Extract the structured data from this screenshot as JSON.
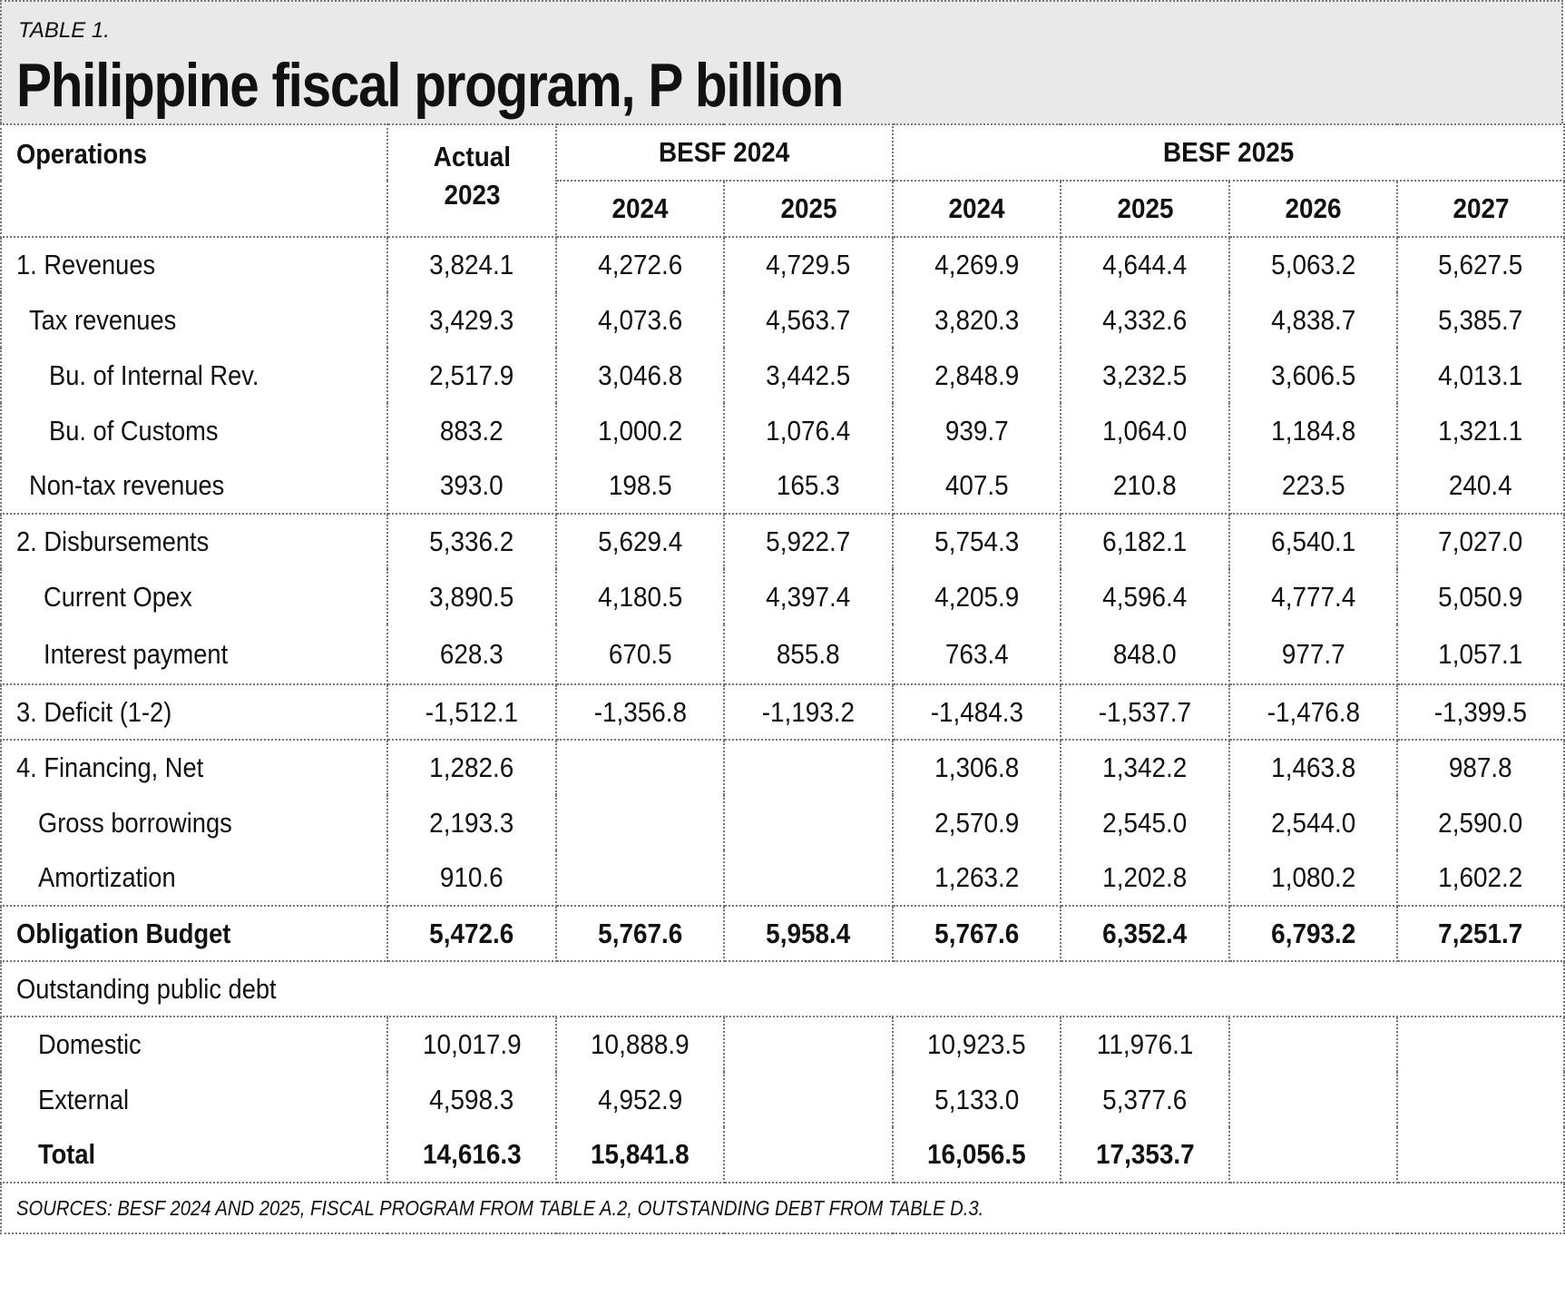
{
  "label": "TABLE 1.",
  "title": "Philippine fiscal program, P billion",
  "headers": {
    "operations": "Operations",
    "actual_line1": "Actual",
    "actual_line2": "2023",
    "besf2024": "BESF 2024",
    "besf2025": "BESF 2025",
    "years": [
      "2024",
      "2025",
      "2024",
      "2025",
      "2026",
      "2027"
    ]
  },
  "rows": [
    {
      "label": "1. Revenues",
      "values": [
        "3,824.1",
        "4,272.6",
        "4,729.5",
        "4,269.9",
        "4,644.4",
        "5,063.2",
        "5,627.5"
      ]
    },
    {
      "label": "Tax revenues",
      "values": [
        "3,429.3",
        "4,073.6",
        "4,563.7",
        "3,820.3",
        "4,332.6",
        "4,838.7",
        "5,385.7"
      ]
    },
    {
      "label": "Bu. of Internal Rev.",
      "values": [
        "2,517.9",
        "3,046.8",
        "3,442.5",
        "2,848.9",
        "3,232.5",
        "3,606.5",
        "4,013.1"
      ]
    },
    {
      "label": "Bu. of Customs",
      "values": [
        "883.2",
        "1,000.2",
        "1,076.4",
        "939.7",
        "1,064.0",
        "1,184.8",
        "1,321.1"
      ]
    },
    {
      "label": "Non-tax revenues",
      "values": [
        "393.0",
        "198.5",
        "165.3",
        "407.5",
        "210.8",
        "223.5",
        "240.4"
      ]
    },
    {
      "label": "2. Disbursements",
      "values": [
        "5,336.2",
        "5,629.4",
        "5,922.7",
        "5,754.3",
        "6,182.1",
        "6,540.1",
        "7,027.0"
      ]
    },
    {
      "label": "Current Opex",
      "values": [
        "3,890.5",
        "4,180.5",
        "4,397.4",
        "4,205.9",
        "4,596.4",
        "4,777.4",
        "5,050.9"
      ]
    },
    {
      "label": "Interest payment",
      "values": [
        "628.3",
        "670.5",
        "855.8",
        "763.4",
        "848.0",
        "977.7",
        "1,057.1"
      ]
    },
    {
      "label": "3. Deficit (1-2)",
      "values": [
        "-1,512.1",
        "-1,356.8",
        "-1,193.2",
        "-1,484.3",
        "-1,537.7",
        "-1,476.8",
        "-1,399.5"
      ]
    },
    {
      "label": "4. Financing, Net",
      "values": [
        "1,282.6",
        "",
        "",
        "1,306.8",
        "1,342.2",
        "1,463.8",
        "987.8"
      ]
    },
    {
      "label": "Gross borrowings",
      "values": [
        "2,193.3",
        "",
        "",
        "2,570.9",
        "2,545.0",
        "2,544.0",
        "2,590.0"
      ]
    },
    {
      "label": "Amortization",
      "values": [
        "910.6",
        "",
        "",
        "1,263.2",
        "1,202.8",
        "1,080.2",
        "1,602.2"
      ]
    },
    {
      "label": "Obligation Budget",
      "values": [
        "5,472.6",
        "5,767.6",
        "5,958.4",
        "5,767.6",
        "6,352.4",
        "6,793.2",
        "7,251.7"
      ]
    },
    {
      "label": "Outstanding public debt"
    },
    {
      "label": "Domestic",
      "values": [
        "10,017.9",
        "10,888.9",
        "",
        "10,923.5",
        "11,976.1",
        "",
        ""
      ]
    },
    {
      "label": "External",
      "values": [
        "4,598.3",
        "4,952.9",
        "",
        "5,133.0",
        "5,377.6",
        "",
        ""
      ]
    },
    {
      "label": "Total",
      "values": [
        "14,616.3",
        "15,841.8",
        "",
        "16,056.5",
        "17,353.7",
        "",
        ""
      ]
    }
  ],
  "sources": "SOURCES: BESF 2024 AND 2025, FISCAL PROGRAM FROM TABLE A.2, OUTSTANDING DEBT FROM TABLE D.3."
}
